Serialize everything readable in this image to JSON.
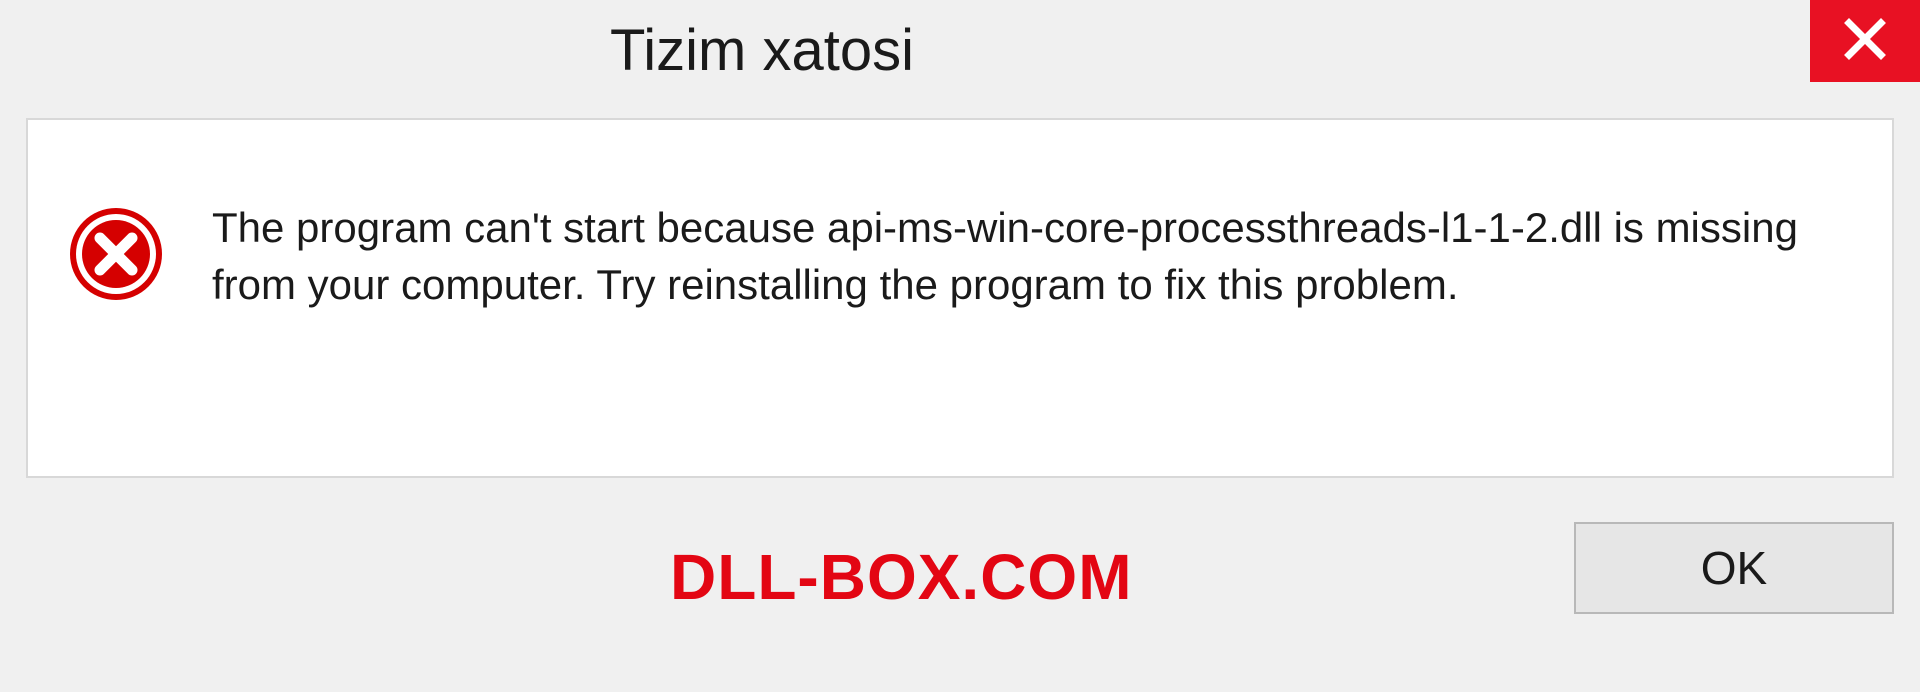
{
  "dialog": {
    "title": "Tizim xatosi",
    "message": "The program can't start because api-ms-win-core-processthreads-l1-1-2.dll is missing from your computer. Try reinstalling the program to fix this problem.",
    "ok_label": "OK"
  },
  "watermark": "DLL-BOX.COM",
  "colors": {
    "close_red": "#e81123",
    "error_red": "#d50000",
    "watermark_red": "#e30613"
  }
}
